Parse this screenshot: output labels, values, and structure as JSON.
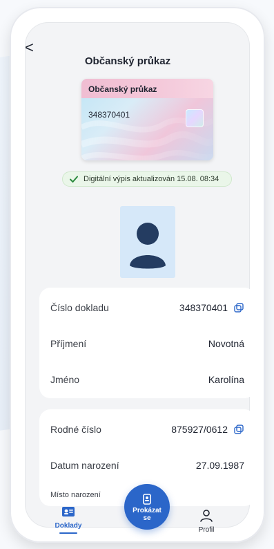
{
  "header": {
    "back_label": "<",
    "title": "Občanský průkaz"
  },
  "card_preview": {
    "title": "Občanský průkaz",
    "number": "348370401"
  },
  "status": {
    "text": "Digitální výpis aktualizován 15.08. 08:34"
  },
  "details_primary": [
    {
      "label": "Číslo dokladu",
      "value": "348370401",
      "copy": true
    },
    {
      "label": "Příjmení",
      "value": "Novotná",
      "copy": false
    },
    {
      "label": "Jméno",
      "value": "Karolína",
      "copy": false
    }
  ],
  "details_secondary": [
    {
      "label": "Rodné číslo",
      "value": "875927/0612",
      "copy": true
    },
    {
      "label": "Datum narození",
      "value": "27.09.1987",
      "copy": false
    }
  ],
  "details_secondary_more": {
    "label": "Místo narození"
  },
  "bottom_nav": {
    "left": {
      "label": "Doklady",
      "icon": "id-card-icon"
    },
    "center": {
      "label": "Prokázat\nse",
      "icon": "badge-icon"
    },
    "right": {
      "label": "Profil",
      "icon": "user-icon"
    }
  },
  "colors": {
    "primary": "#2b66c9",
    "status_bg": "#eaf6e9",
    "status_border": "#cfe8cb",
    "avatar_bg": "#d6e8f9"
  }
}
